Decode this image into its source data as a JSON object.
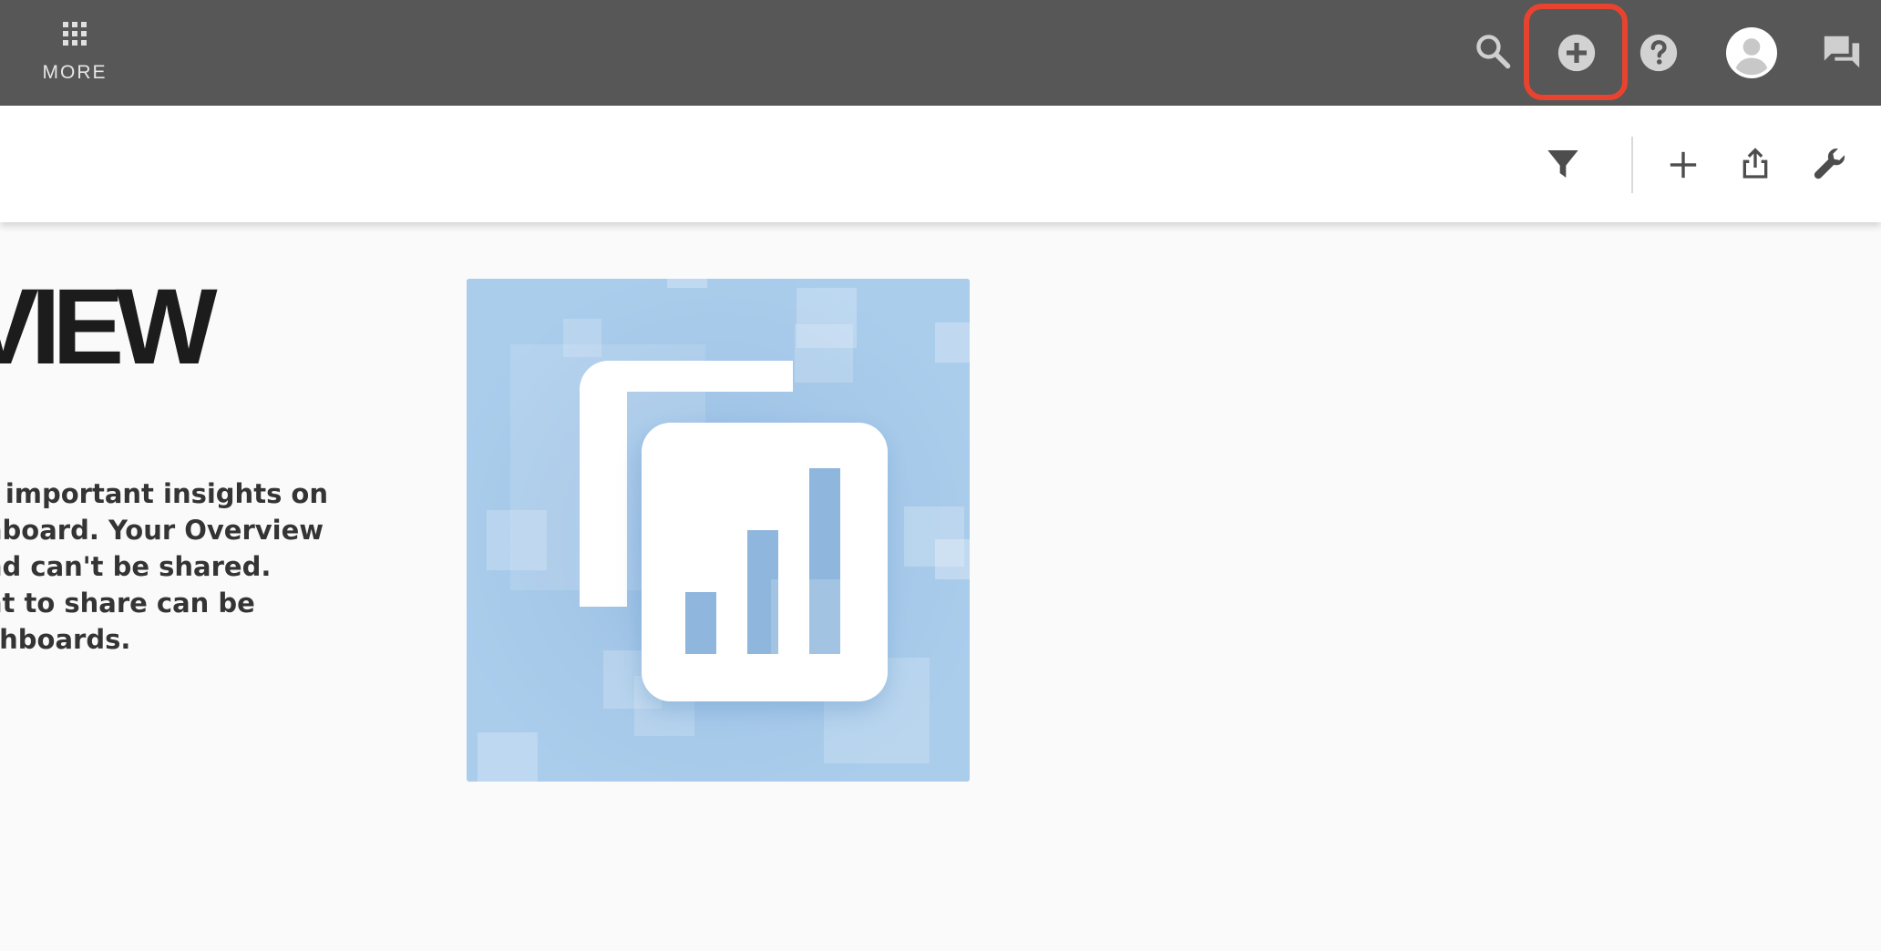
{
  "topbar": {
    "more_label": "MORE",
    "icons": {
      "search": "search-icon",
      "create": "add-circle-icon",
      "help": "help-icon",
      "account": "account-icon",
      "messages": "chat-icon"
    },
    "highlight_color": "#e8432f",
    "background": "#575757"
  },
  "toolbar": {
    "icons": {
      "filter": "filter-icon",
      "add": "plus-icon",
      "share": "share-icon",
      "settings": "wrench-icon"
    }
  },
  "main": {
    "title": "VIEW",
    "intro_lines": [
      "t important insights on",
      "nboard. Your Overview",
      "nd can't be shared.",
      "nt to share can be",
      "shboards."
    ],
    "illustration_icon": "bar-chart-card-icon",
    "illustration_color": "#a9cbea"
  }
}
